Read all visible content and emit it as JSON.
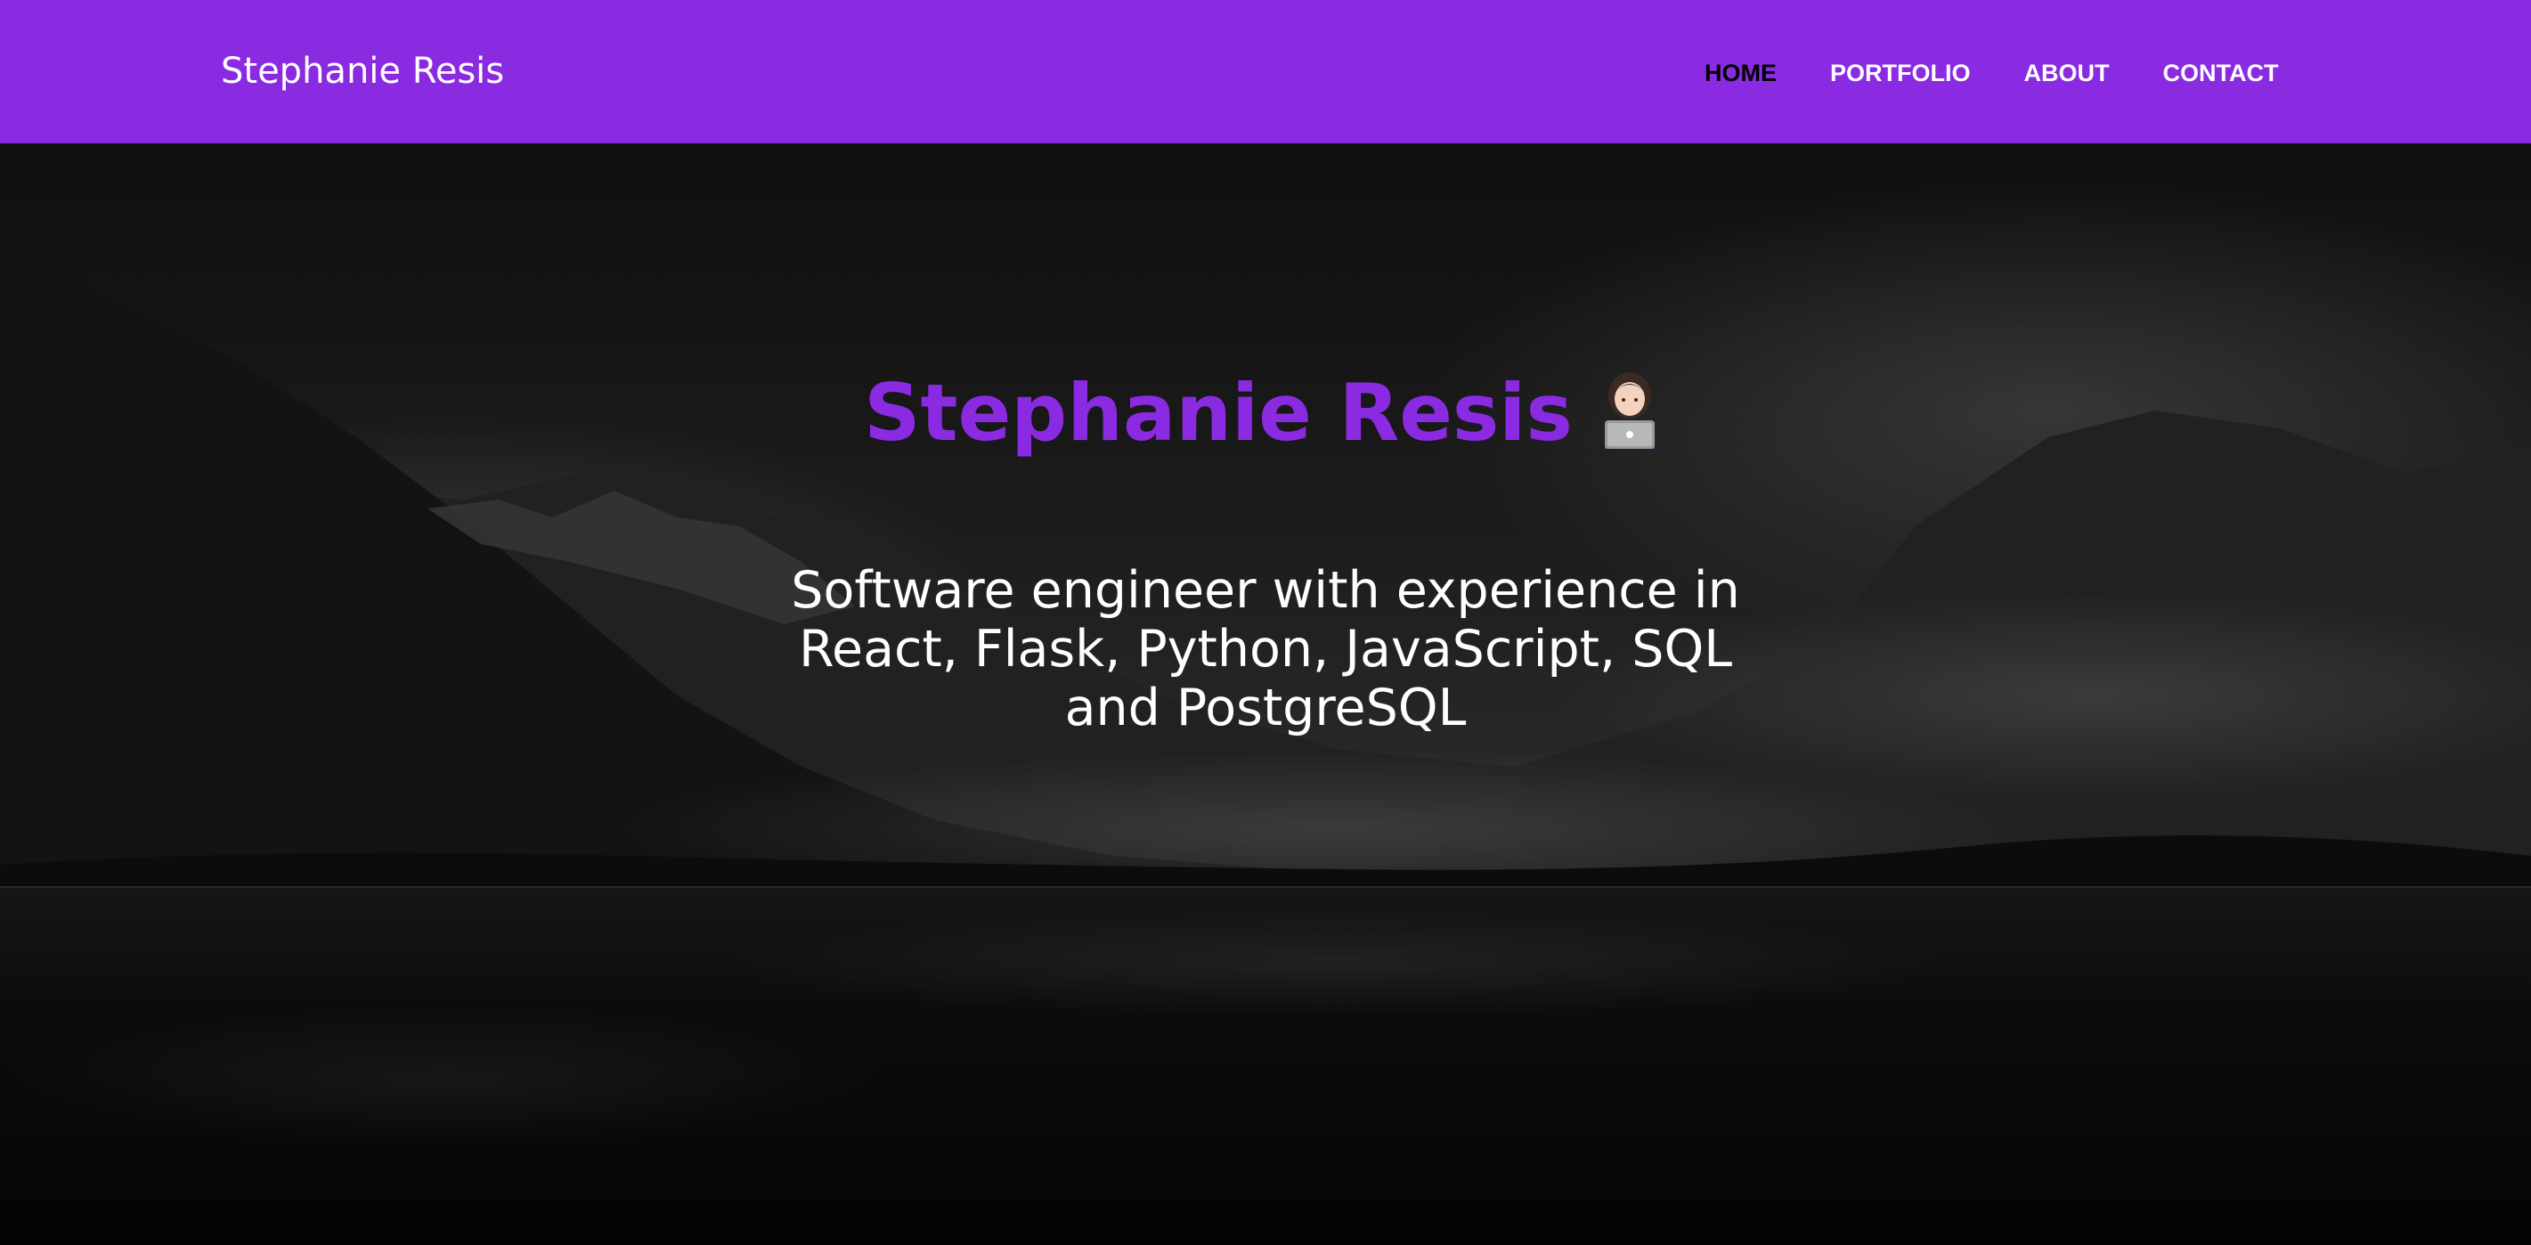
{
  "navbar": {
    "brand": "Stephanie Resis",
    "links": [
      {
        "label": "HOME",
        "active": true
      },
      {
        "label": "PORTFOLIO",
        "active": false
      },
      {
        "label": "ABOUT",
        "active": false
      },
      {
        "label": "CONTACT",
        "active": false
      }
    ],
    "background_color": "#8a2be2",
    "active_link_color": "#000000"
  },
  "hero": {
    "title": "Stephanie Resis",
    "title_emoji": "technologist-at-laptop-icon",
    "title_color": "#8a2be2",
    "subtitle": "Software engineer with experience in React, Flask, Python, JavaScript, SQL and PostgreSQL",
    "background": "grayscale mountain lake landscape"
  }
}
